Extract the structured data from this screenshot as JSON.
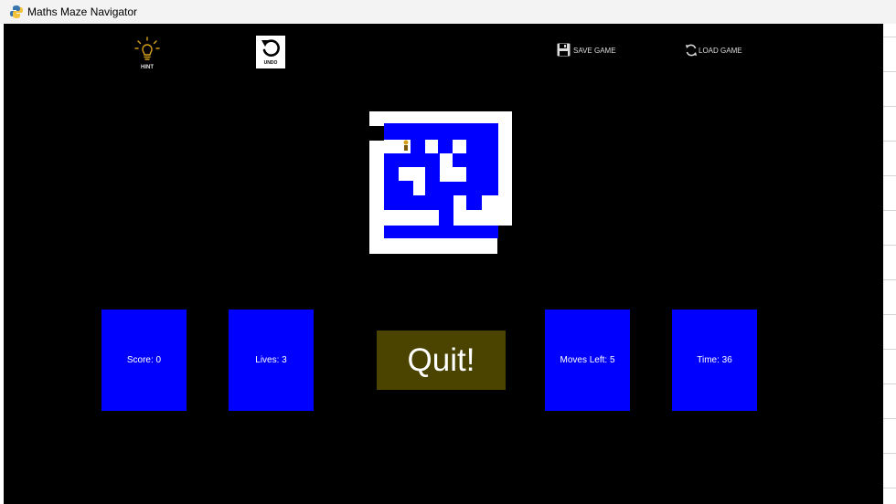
{
  "window": {
    "title": "Maths Maze Navigator",
    "icon": "python-logo-icon"
  },
  "toolbar": {
    "hint": {
      "label": "HINT",
      "icon": "lightbulb-icon"
    },
    "undo": {
      "label": "UNDO",
      "icon": "undo-icon"
    },
    "save": {
      "label": "SAVE GAME",
      "icon": "floppy-disk-icon"
    },
    "load": {
      "label": "LOAD GAME",
      "icon": "refresh-icon"
    }
  },
  "stats": {
    "score": "Score: 0",
    "lives": "Lives: 3",
    "moves": "Moves Left: 5",
    "time": "Time: 36"
  },
  "quit_label": "Quit!",
  "colors": {
    "background": "#000000",
    "maze_wall": "#0000ff",
    "maze_path": "#ffffff",
    "stat_box": "#0000ff",
    "quit_button": "#4a4400",
    "hint_icon": "#d4a017"
  }
}
